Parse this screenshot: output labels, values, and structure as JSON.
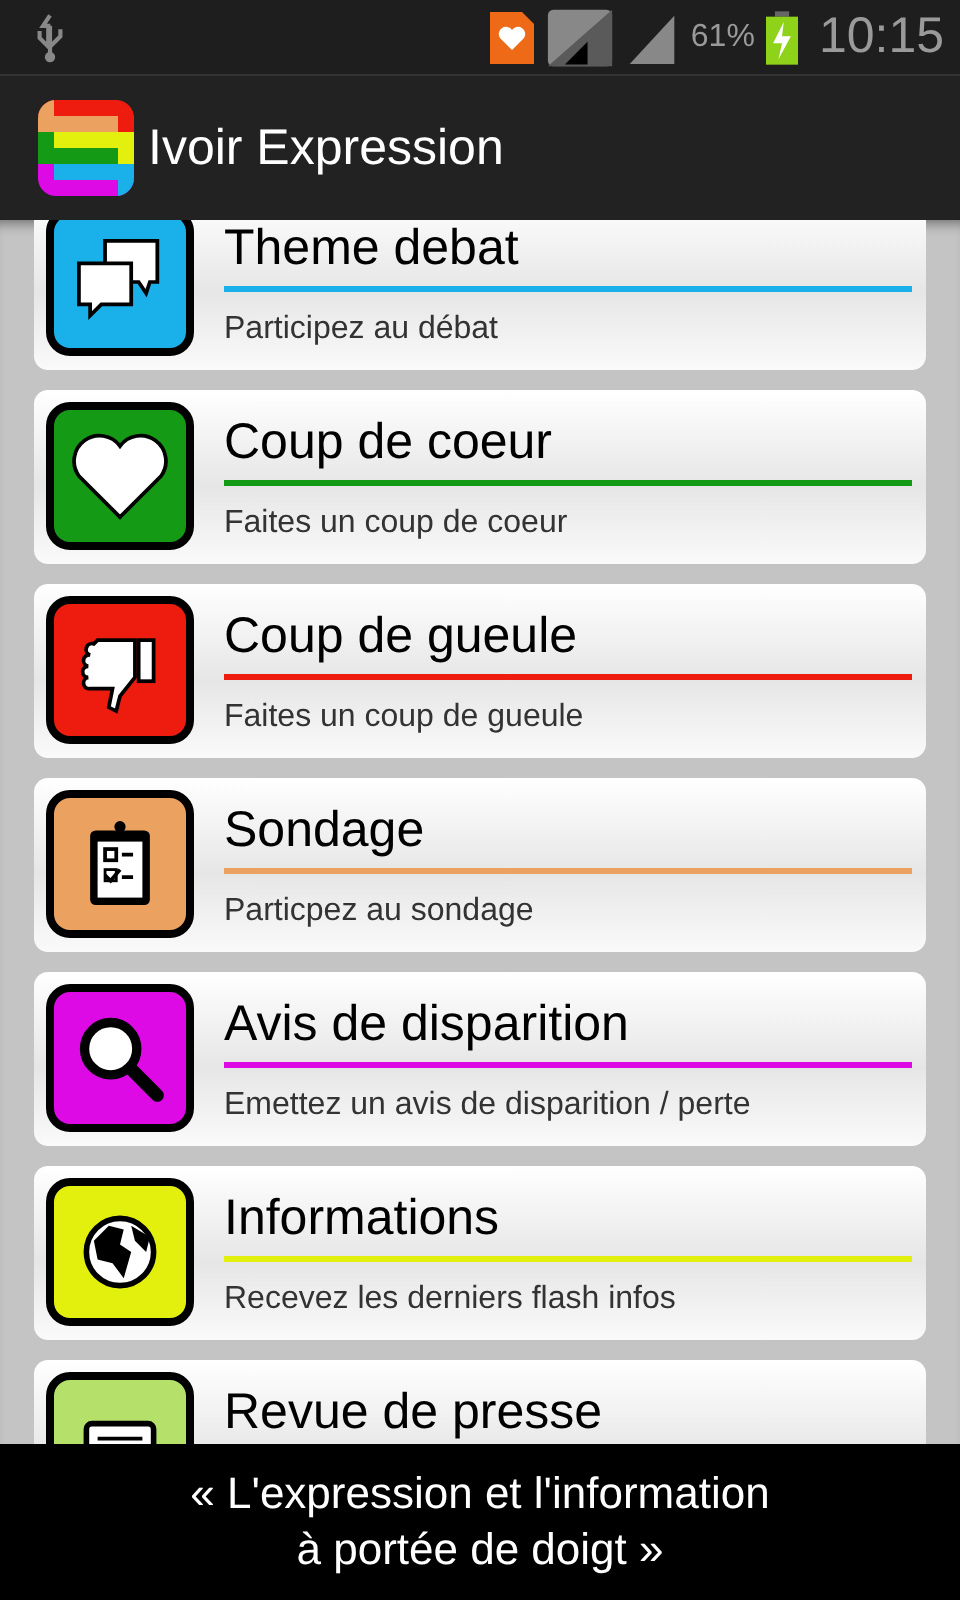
{
  "status_bar": {
    "battery": "61%",
    "time": "10:15"
  },
  "action_bar": {
    "title": "Ivoir Expression"
  },
  "items": [
    {
      "title": "Theme debat",
      "subtitle": "Participez au débat",
      "color": "#1ab0ea",
      "kind": "chat"
    },
    {
      "title": "Coup de coeur",
      "subtitle": "Faites un coup de coeur",
      "color": "#159a15",
      "kind": "heart"
    },
    {
      "title": "Coup de gueule",
      "subtitle": "Faites un coup de gueule",
      "color": "#ee1c0e",
      "kind": "thumbs-down"
    },
    {
      "title": "Sondage",
      "subtitle": "Particpez au sondage",
      "color": "#eba160",
      "kind": "clipboard"
    },
    {
      "title": "Avis de disparition",
      "subtitle": "Emettez un avis de disparition / perte",
      "color": "#dd0ae6",
      "kind": "magnifier"
    },
    {
      "title": "Informations",
      "subtitle": "Recevez les derniers flash infos",
      "color": "#e3f00e",
      "kind": "globe"
    },
    {
      "title": "Revue de presse",
      "color": "#b5e06a",
      "kind": "newspaper"
    }
  ],
  "footer": {
    "slogan": "« L'expression et l'information\nà portée de doigt »"
  }
}
